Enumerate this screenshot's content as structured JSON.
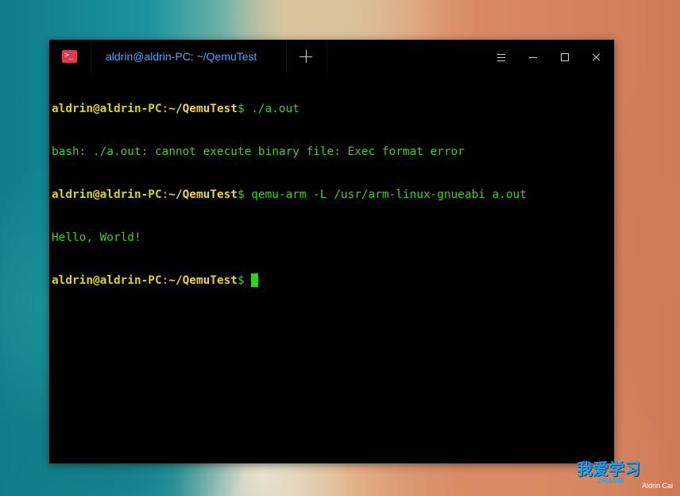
{
  "window": {
    "tab_title": "aldrin@aldrin-PC: ~/QemuTest",
    "app_icon_glyph": ">_",
    "accent_color": "#47a8ff",
    "icon_color": "#e2374e"
  },
  "terminal": {
    "lines": [
      {
        "user": "aldrin@aldrin-PC",
        "colon": ":",
        "path": "~/QemuTest",
        "cmd": "$ ./a.out"
      },
      {
        "output": "bash: ./a.out: cannot execute binary file: Exec format error"
      },
      {
        "user": "aldrin@aldrin-PC",
        "colon": ":",
        "path": "~/QemuTest",
        "cmd": "$ qemu-arm -L /usr/arm-linux-gnueabi a.out"
      },
      {
        "output": "Hello, World!"
      },
      {
        "user": "aldrin@aldrin-PC",
        "colon": ":",
        "path": "~/QemuTest",
        "cmd": "$ "
      }
    ],
    "colors": {
      "prompt": "#d9d21f",
      "output": "#3fcf1a",
      "cursor": "#34d01a"
    }
  },
  "watermark": {
    "logo": "我爱学习",
    "sub": "ZHANW",
    "author": "Aldrin Cai"
  },
  "icons": [
    "terminal-app-icon",
    "plus-icon",
    "menu-icon",
    "minimize-icon",
    "maximize-icon",
    "close-icon"
  ]
}
